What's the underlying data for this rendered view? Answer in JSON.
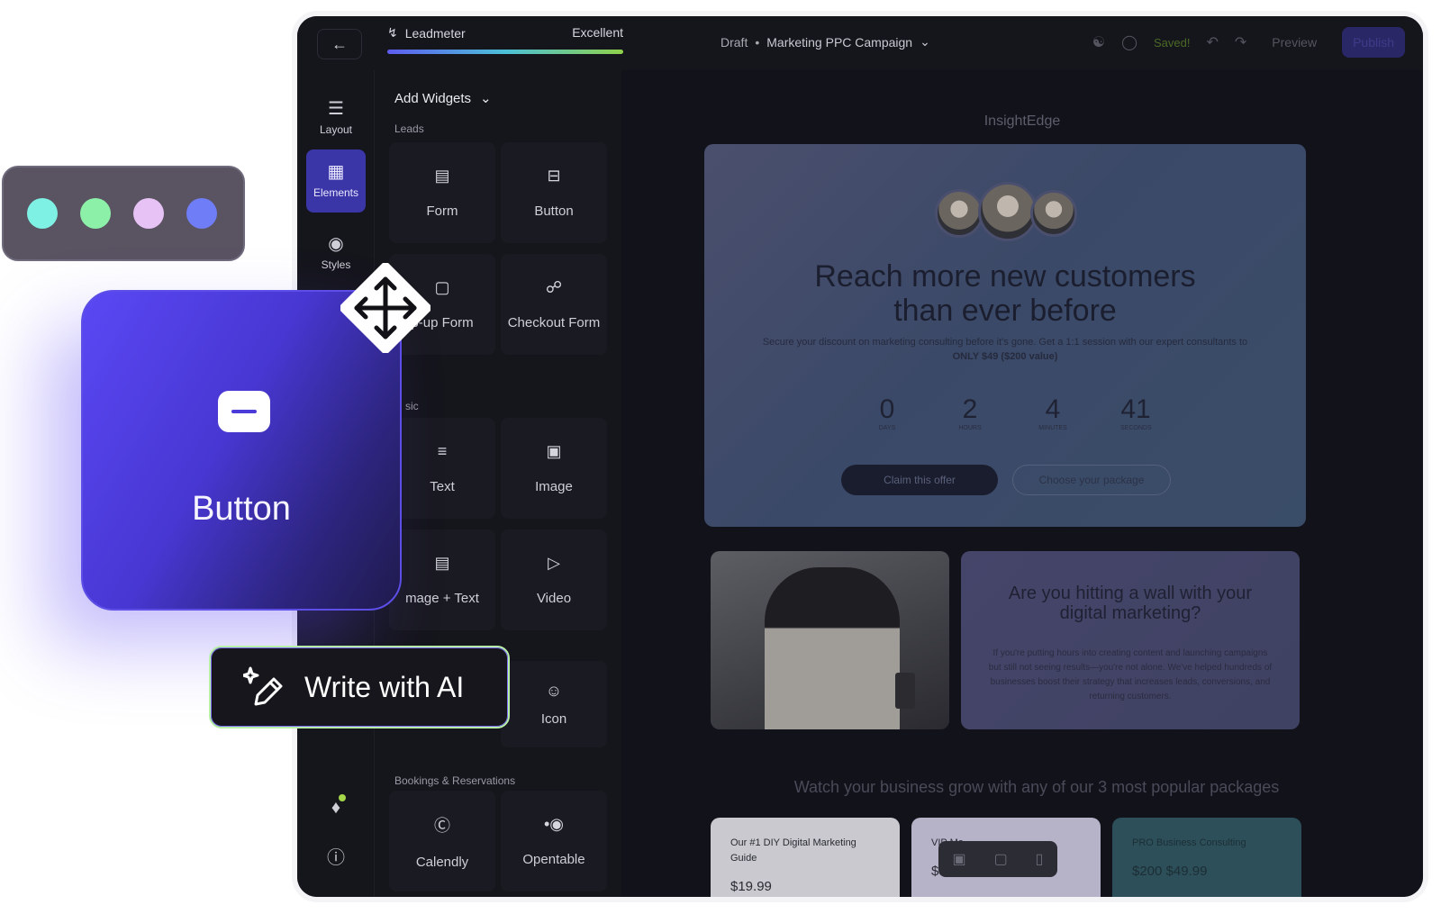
{
  "topbar": {
    "leadmeter_label": "Leadmeter",
    "leadmeter_status": "Excellent",
    "draft_label": "Draft",
    "campaign_name": "Marketing PPC Campaign",
    "saved_label": "Saved!",
    "preview_label": "Preview",
    "publish_label": "Publish"
  },
  "rail": {
    "items": [
      {
        "label": "Layout",
        "icon": "layers-icon"
      },
      {
        "label": "Elements",
        "icon": "elements-icon"
      },
      {
        "label": "Styles",
        "icon": "palette-icon"
      }
    ]
  },
  "panel": {
    "title": "Add Widgets",
    "sections": {
      "leads": "Leads",
      "basic": "sic",
      "bookings": "Bookings & Reservations"
    },
    "widgets": {
      "form": "Form",
      "button": "Button",
      "popup_form": "p-up Form",
      "checkout_form": "Checkout Form",
      "text": "Text",
      "image": "Image",
      "image_text": "mage + Text",
      "video": "Video",
      "icon": "Icon",
      "calendly": "Calendly",
      "opentable": "Opentable"
    }
  },
  "canvas": {
    "brand": "InsightEdge",
    "hero_title_line1": "Reach more new customers",
    "hero_title_line2": "than ever before",
    "hero_sub": "Secure your discount on marketing consulting before it's gone. Get a 1:1 session with our expert consultants to",
    "hero_sub_bold": "ONLY $49 ($200 value)",
    "countdown": [
      {
        "value": "0",
        "unit": "DAYS"
      },
      {
        "value": "2",
        "unit": "HOURS"
      },
      {
        "value": "4",
        "unit": "MINUTES"
      },
      {
        "value": "41",
        "unit": "SECONDS"
      }
    ],
    "claim_label": "Claim this offer",
    "choose_label": "Choose your package",
    "wall_title": "Are you hitting a wall with your digital marketing?",
    "wall_body": "If you're putting hours into creating content and launching campaigns but still not seeing results—you're not alone. We've helped hundreds of businesses boost their strategy that increases leads, conversions, and returning customers.",
    "packages_title": "Watch your business grow with any of our 3 most popular packages",
    "packages": [
      {
        "name": "Our #1 DIY Digital Marketing Guide",
        "price": "$19.99"
      },
      {
        "name": "VIP Ma",
        "price": "$39.99"
      },
      {
        "name": "PRO Business Consulting",
        "price": "$200 $49.99"
      }
    ]
  },
  "overlays": {
    "swatch_colors": [
      "#7ff0e4",
      "#8df0a8",
      "#e7c3f5",
      "#6f7df6"
    ],
    "button_card_label": "Button",
    "ai_label": "Write with AI"
  },
  "colors": {
    "accent": "#5a48f4",
    "active_rail": "#3b36a8",
    "ai_border": "#b9f0a8"
  }
}
